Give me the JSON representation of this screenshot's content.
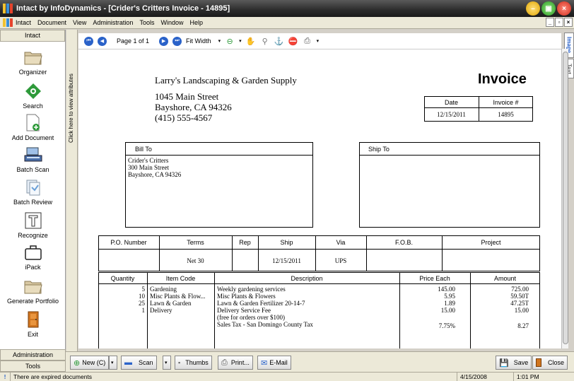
{
  "window": {
    "title": "Intact by InfoDynamics - [Crider's Critters Invoice - 14895]"
  },
  "menu": {
    "items": [
      "Intact",
      "Document",
      "View",
      "Administration",
      "Tools",
      "Window",
      "Help"
    ],
    "mdi_buttons": [
      "_",
      "×"
    ]
  },
  "sidebar": {
    "header": "Intact",
    "items": [
      {
        "label": "Organizer",
        "icon": "folder-icon"
      },
      {
        "label": "Search",
        "icon": "search-icon"
      },
      {
        "label": "Add Document",
        "icon": "add-document-icon"
      },
      {
        "label": "Batch Scan",
        "icon": "scanner-icon"
      },
      {
        "label": "Batch Review",
        "icon": "batch-review-icon"
      },
      {
        "label": "Recognize",
        "icon": "recognize-icon"
      },
      {
        "label": "iPack",
        "icon": "briefcase-icon"
      },
      {
        "label": "Generate Portfolio",
        "icon": "portfolio-folder-icon"
      },
      {
        "label": "Exit",
        "icon": "exit-door-icon"
      }
    ],
    "administration": "Administration",
    "tools": "Tools"
  },
  "vstrip": {
    "label": "Click here to view attributes"
  },
  "viewer_toolbar": {
    "page_info": "Page 1 of 1",
    "fit": "Fit Width"
  },
  "right_tabs": {
    "image": "Image",
    "text": "Text"
  },
  "invoice": {
    "company": "Larry's Landscaping & Garden Supply",
    "address1": "1045 Main Street",
    "address2": "Bayshore, CA 94326",
    "phone": "(415) 555-4567",
    "title": "Invoice",
    "date_label": "Date",
    "invoice_no_label": "Invoice #",
    "date": "12/15/2011",
    "invoice_no": "14895",
    "bill_to_label": "Bill To",
    "ship_to_label": "Ship To",
    "bill_to_lines": [
      "Crider's Critters",
      "300 Main Street",
      "Bayshore, CA 94326"
    ],
    "headers1": [
      "P.O. Number",
      "Terms",
      "Rep",
      "Ship",
      "Via",
      "F.O.B.",
      "Project"
    ],
    "row1": [
      "",
      "Net 30",
      "",
      "12/15/2011",
      "UPS",
      "",
      ""
    ],
    "headers2": [
      "Quantity",
      "Item Code",
      "Description",
      "Price Each",
      "Amount"
    ],
    "quantities": [
      "5",
      "10",
      "25",
      "1",
      "",
      ""
    ],
    "item_codes": [
      "Gardening",
      "Misc Plants & Flow...",
      "Lawn & Garden",
      "Delivery",
      "",
      ""
    ],
    "descriptions": [
      "Weekly gardening services",
      "Misc Plants & Flowers",
      "Lawn & Garden Fertilizer 20-14-7",
      "Delivery Service Fee",
      "(free for orders over $100)",
      "Sales Tax - San Domingo County Tax"
    ],
    "prices": [
      "145.00",
      "5.95",
      "1.89",
      "15.00",
      "",
      "7.75%"
    ],
    "amounts": [
      "725.00",
      "59.50T",
      "47.25T",
      "15.00",
      "",
      "8.27"
    ]
  },
  "bottom_toolbar": {
    "new": "New (C)",
    "scan": "Scan",
    "thumbs": "Thumbs",
    "print": "Print...",
    "email": "E-Mail",
    "save": "Save",
    "close": "Close"
  },
  "status": {
    "message": "There are expired documents",
    "date": "4/15/2008",
    "time": "1:01 PM"
  },
  "colors": {
    "accent_blue": "#2a62c9",
    "green": "#2e9a3a",
    "red": "#c0312b"
  }
}
